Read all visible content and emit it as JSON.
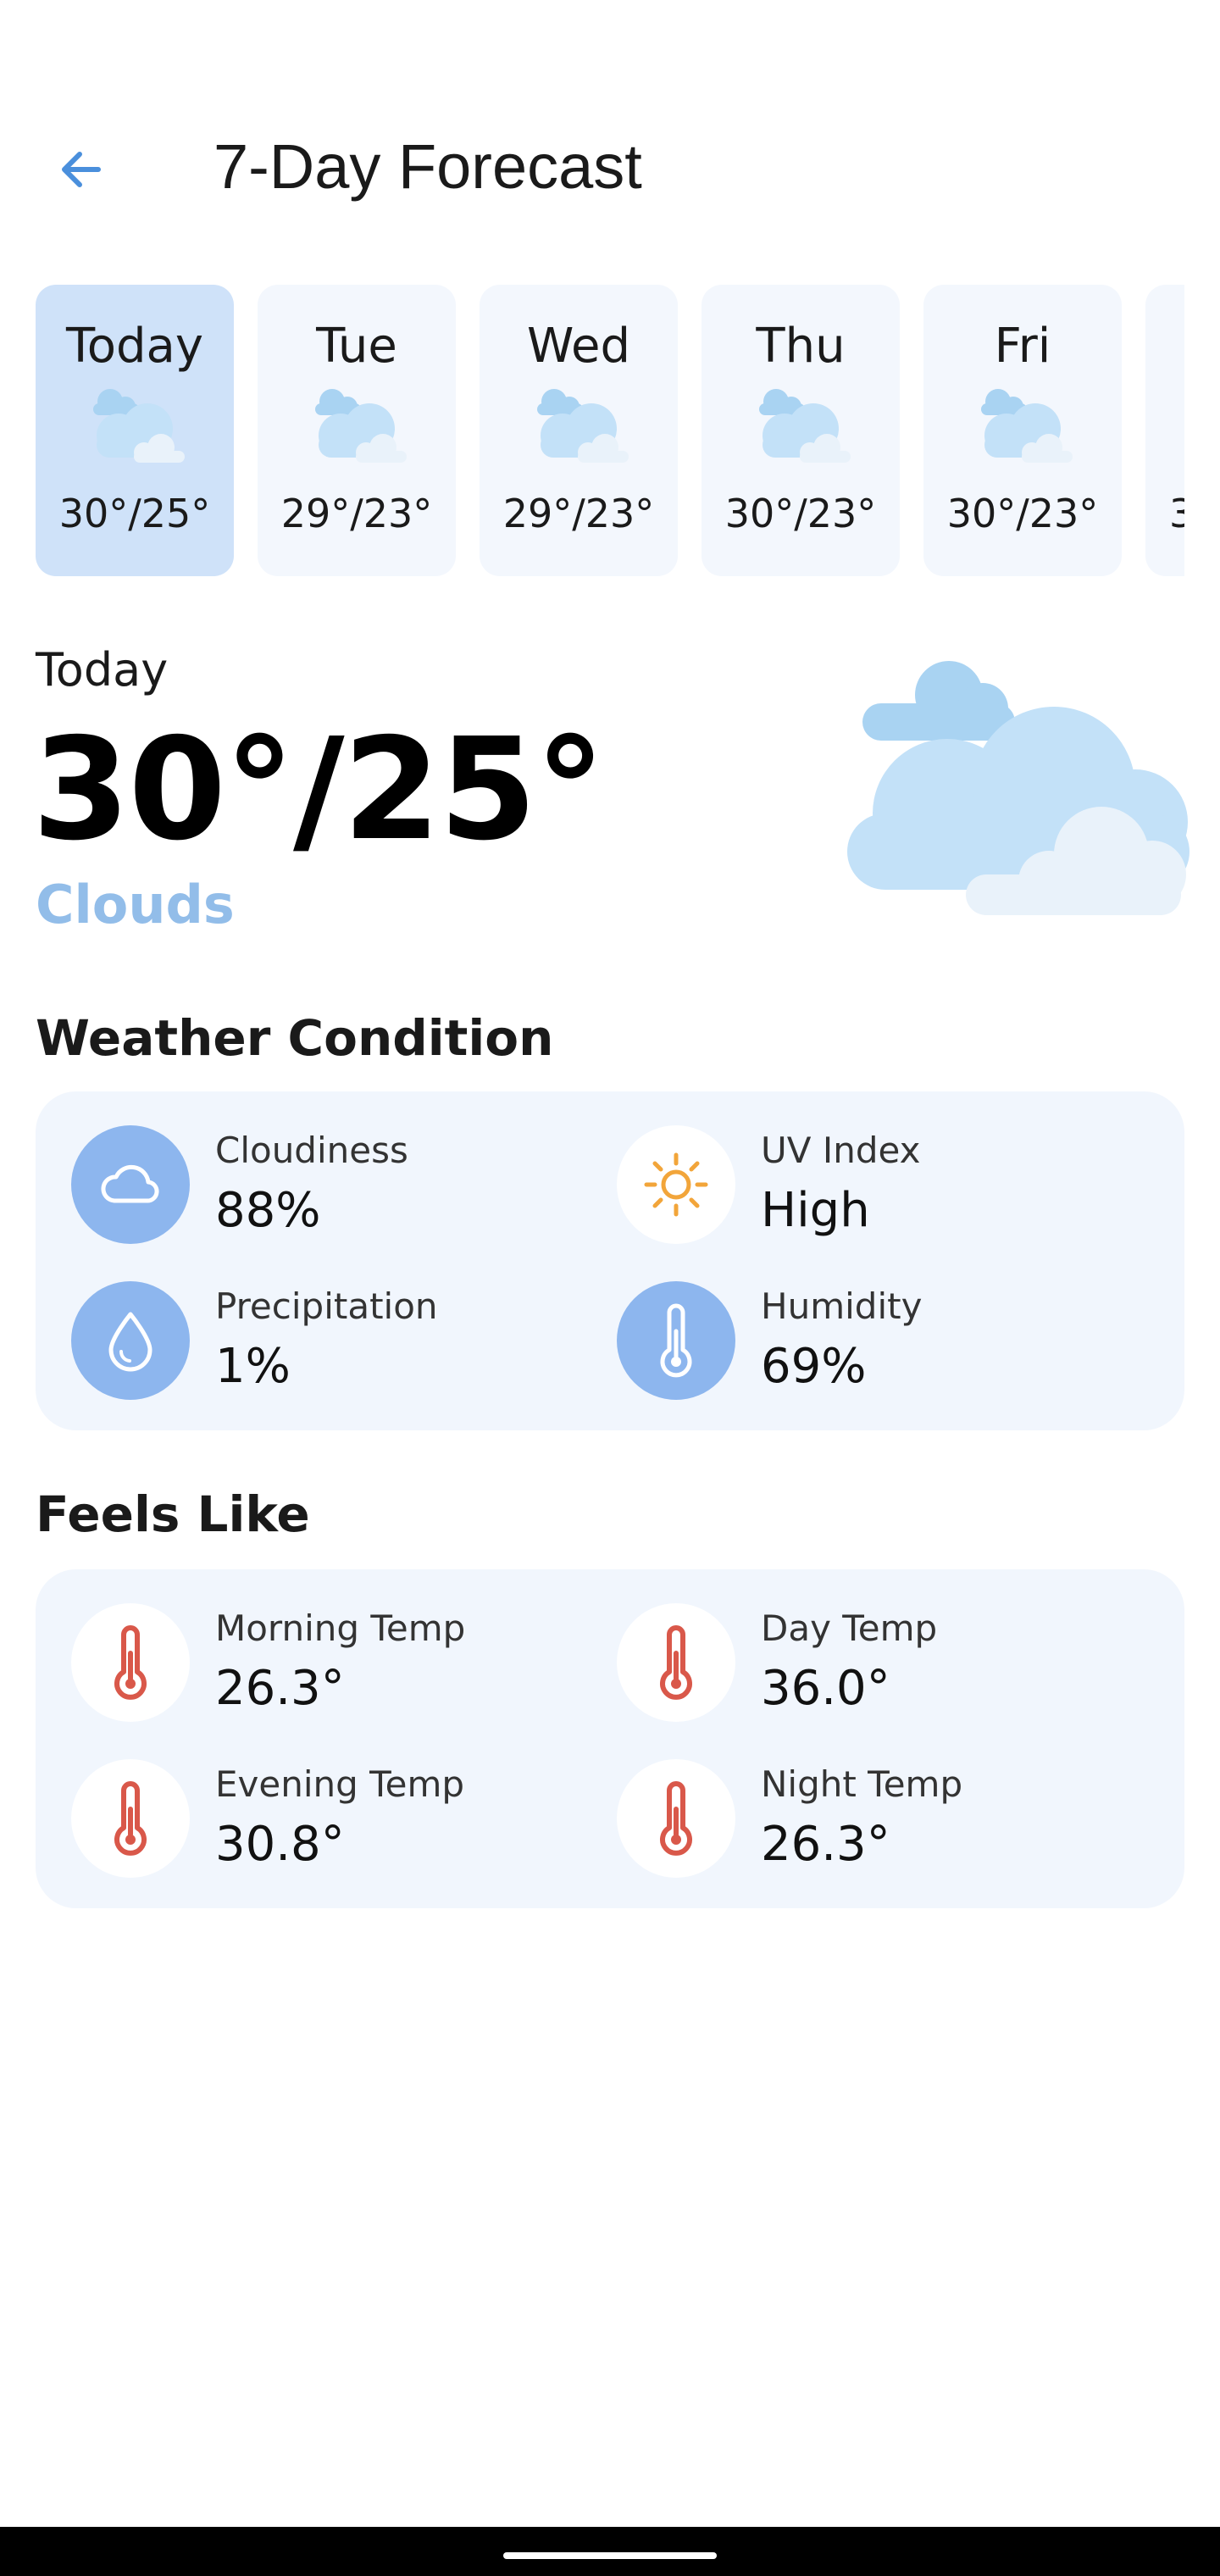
{
  "header": {
    "title": "7-Day Forecast",
    "back_icon": "arrow-left-icon"
  },
  "accent_color": "#4a8fdc",
  "days": [
    {
      "name": "Today",
      "temp": "30°/25°",
      "icon": "clouds-icon",
      "selected": true
    },
    {
      "name": "Tue",
      "temp": "29°/23°",
      "icon": "clouds-icon",
      "selected": false
    },
    {
      "name": "Wed",
      "temp": "29°/23°",
      "icon": "clouds-icon",
      "selected": false
    },
    {
      "name": "Thu",
      "temp": "30°/23°",
      "icon": "clouds-icon",
      "selected": false
    },
    {
      "name": "Fri",
      "temp": "30°/23°",
      "icon": "clouds-icon",
      "selected": false
    },
    {
      "name": "",
      "temp": "3",
      "icon": "",
      "selected": false
    }
  ],
  "today": {
    "label": "Today",
    "temp": "30°/25°",
    "condition": "Clouds",
    "condition_color": "#92bde9"
  },
  "weather_condition": {
    "title": "Weather Condition",
    "items": [
      {
        "label": "Cloudiness",
        "value": "88%",
        "icon": "cloud-icon"
      },
      {
        "label": "UV Index",
        "value": "High",
        "icon": "sun-icon"
      },
      {
        "label": "Precipitation",
        "value": "1%",
        "icon": "droplet-icon"
      },
      {
        "label": "Humidity",
        "value": "69%",
        "icon": "thermometer-icon"
      }
    ]
  },
  "feels_like": {
    "title": "Feels Like",
    "items": [
      {
        "label": "Morning Temp",
        "value": "26.3°",
        "icon": "thermometer-icon"
      },
      {
        "label": "Day Temp",
        "value": "36.0°",
        "icon": "thermometer-icon"
      },
      {
        "label": "Evening Temp",
        "value": "30.8°",
        "icon": "thermometer-icon"
      },
      {
        "label": "Night Temp",
        "value": "26.3°",
        "icon": "thermometer-icon"
      }
    ]
  }
}
